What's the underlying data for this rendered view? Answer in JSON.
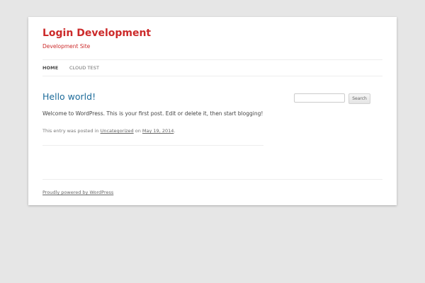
{
  "header": {
    "site_title": "Login Development",
    "site_description": "Development Site"
  },
  "nav": {
    "items": [
      {
        "label": "HOME",
        "current": true
      },
      {
        "label": "CLOUD TEST",
        "current": false
      }
    ]
  },
  "post": {
    "title": "Hello world!",
    "content": "Welcome to WordPress. This is your first post. Edit or delete it, then start blogging!",
    "meta": {
      "prefix": "This entry was posted in ",
      "category": "Uncategorized",
      "middle": " on ",
      "date": "May 19, 2014",
      "suffix": "."
    }
  },
  "sidebar": {
    "search": {
      "value": "",
      "button_label": "Search"
    }
  },
  "footer": {
    "credit": "Proudly powered by WordPress"
  },
  "colors": {
    "background": "#e6e6e6",
    "site_title": "#cc2a2a",
    "post_title": "#1d6b9a"
  }
}
